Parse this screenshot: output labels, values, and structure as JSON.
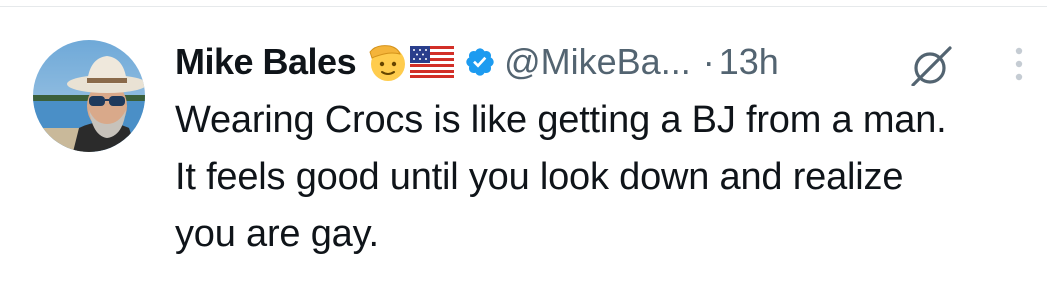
{
  "tweet": {
    "author": {
      "display_name": "Mike Bales",
      "handle": "@MikeBa...",
      "badges": [
        "saluting-face-emoji",
        "us-flag-emoji",
        "verified-badge"
      ],
      "verified_color": "#1d9bf0"
    },
    "separator": "·",
    "timestamp": "13h",
    "text_lines": [
      "Wearing Crocs is like getting a BJ from a man.",
      "It feels good until you look down and realize",
      "you are gay."
    ],
    "icons": [
      "grok-icon",
      "more-icon"
    ]
  },
  "colors": {
    "text_primary": "#0f1419",
    "text_secondary": "#536471",
    "accent": "#1d9bf0",
    "divider": "#e6e9eb"
  }
}
